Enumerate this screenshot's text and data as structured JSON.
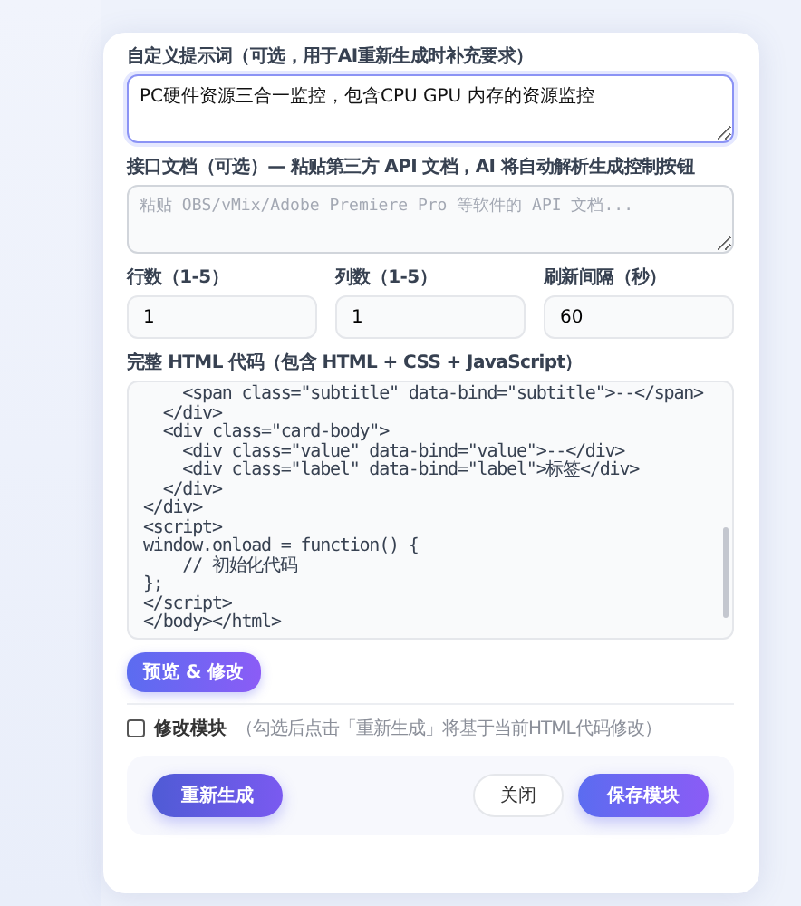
{
  "modal": {
    "prompt": {
      "label": "自定义提示词（可选，用于AI重新生成时补充要求）",
      "value": "PC硬件资源三合一监控，包含CPU GPU 内存的资源监控",
      "focused": true
    },
    "api_doc": {
      "label": "接口文档（可选）— 粘贴第三方 API 文档，AI 将自动解析生成控制按钮",
      "placeholder": "粘贴 OBS/vMix/Adobe Premiere Pro 等软件的 API 文档..."
    },
    "number_fields": [
      {
        "label": "行数（1-5）",
        "value": "1"
      },
      {
        "label": "列数（1-5）",
        "value": "1"
      },
      {
        "label": "刷新间隔（秒）",
        "value": "60"
      }
    ],
    "code": {
      "label": "完整 HTML 代码（包含 HTML + CSS + JavaScript）",
      "lines": [
        "    <span class=\"subtitle\" data-bind=\"subtitle\">--</span>",
        "  </div>",
        "  <div class=\"card-body\">",
        "    <div class=\"value\" data-bind=\"value\">--</div>",
        "    <div class=\"label\" data-bind=\"label\">标签</div>",
        "  </div>",
        "</div>",
        "<script>",
        "window.onload = function() {",
        "    // 初始化代码",
        "};",
        "</script>",
        "</body></html>"
      ]
    },
    "preview_button": "预览 & 修改",
    "modify": {
      "label": "修改模块",
      "hint": "（勾选后点击「重新生成」将基于当前HTML代码修改）",
      "checked": false
    },
    "regenerate_button": "重新生成",
    "close_button": "关闭",
    "save_button": "保存模块"
  }
}
